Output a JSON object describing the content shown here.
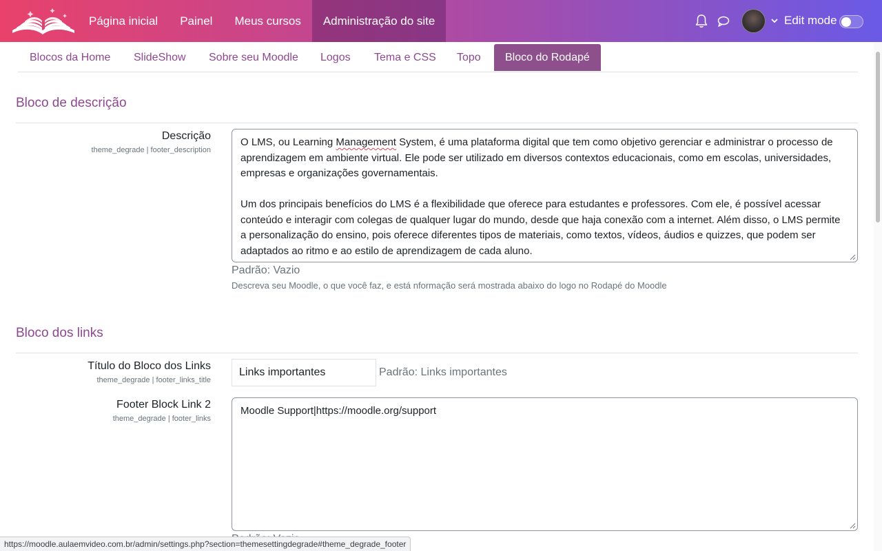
{
  "navbar": {
    "logo_icon": "open-book-logo-icon",
    "links": [
      {
        "label": "Página inicial"
      },
      {
        "label": "Painel"
      },
      {
        "label": "Meus cursos"
      },
      {
        "label": "Administração do site",
        "active": true
      }
    ],
    "notifications_icon": "bell-icon",
    "messages_icon": "chat-bubble-icon",
    "user_menu_icon": "chevron-down-icon",
    "edit_mode_label": "Edit mode",
    "edit_mode_on": false
  },
  "tabs": [
    {
      "label": "Blocos da Home"
    },
    {
      "label": "SlideShow"
    },
    {
      "label": "Sobre seu Moodle"
    },
    {
      "label": "Logos"
    },
    {
      "label": "Tema e CSS"
    },
    {
      "label": "Topo"
    },
    {
      "label": "Bloco do Rodapé",
      "active": true
    }
  ],
  "sections": {
    "description": {
      "title": "Bloco de descrição",
      "label": "Descrição",
      "key": "theme_degrade | footer_description",
      "value_p1_a": "O LMS, ou Learning ",
      "value_p1_spell": "Management",
      "value_p1_b": " System, é uma plataforma digital que tem como objetivo gerenciar e administrar o processo de aprendizagem em ambiente virtual. Ele pode ser utilizado em diversos contextos educacionais, como em escolas, universidades, empresas e organizações governamentais.",
      "value_p2": "Um dos principais benefícios do LMS é a flexibilidade que oferece para estudantes e professores. Com ele, é possível acessar conteúdo e interagir com colegas de qualquer lugar do mundo, desde que haja conexão com a internet. Além disso, o LMS permite a personalização do ensino, pois oferece diferentes tipos de materiais, como textos, vídeos, áudios e quizzes, que podem ser adaptados ao ritmo e ao estilo de aprendizagem de cada aluno.",
      "default": "Padrão: Vazio",
      "help": "Descreva seu Moodle, o que você faz, e está nformação será mostrada abaixo do logo no Rodapé do Moodle"
    },
    "links": {
      "title": "Bloco dos links",
      "title_field": {
        "label": "Título do Bloco dos Links",
        "key": "theme_degrade | footer_links_title",
        "value": "Links importantes",
        "default": "Padrão: Links importantes"
      },
      "link2": {
        "label": "Footer Block Link 2",
        "key": "theme_degrade | footer_links",
        "value": "Moodle Support|https://moodle.org/support",
        "default": "Padrão: Vazio"
      }
    }
  },
  "status_bar": {
    "url": "https://moodle.aulaemvideo.com.br/admin/settings.php?section=themesettingdegrade#theme_degrade_footer"
  },
  "colors": {
    "brand_gradient_start": "#e8426b",
    "brand_gradient_end": "#6a5ae6",
    "accent": "#8e4790",
    "active_tab": "#8e4f8d"
  }
}
